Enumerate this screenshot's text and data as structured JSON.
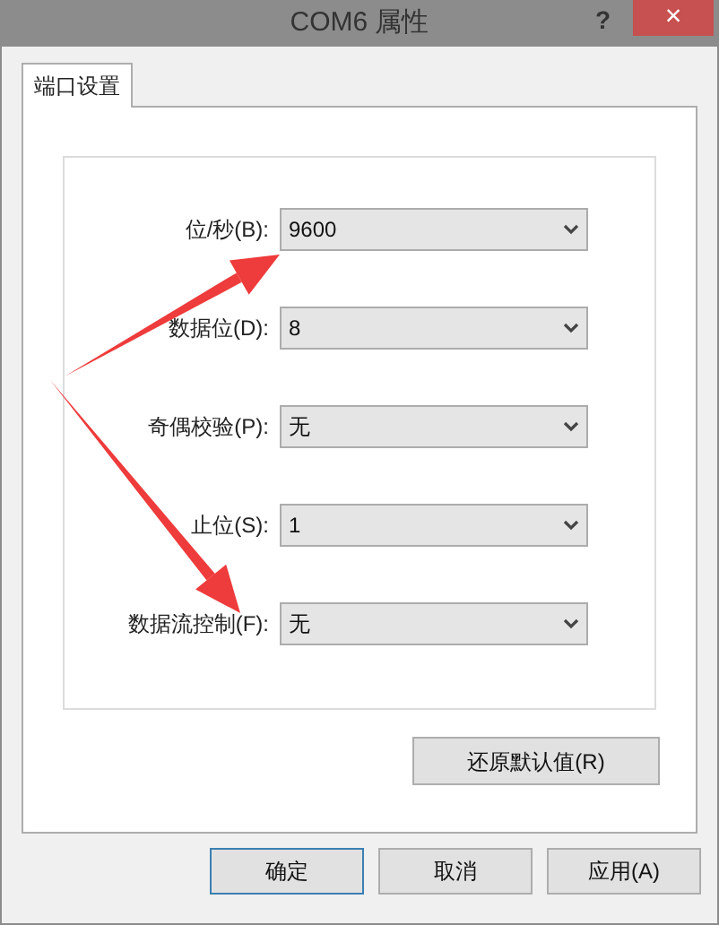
{
  "window": {
    "title": "COM6 属性",
    "help": "?",
    "close": "×"
  },
  "tabs": [
    {
      "label": "端口设置",
      "selected": true
    }
  ],
  "settings": [
    {
      "label": "位/秒(B):",
      "value": "9600"
    },
    {
      "label": "数据位(D):",
      "value": "8"
    },
    {
      "label": "奇偶校验(P):",
      "value": "无"
    },
    {
      "label": "止位(S):",
      "value": "1"
    },
    {
      "label": "数据流控制(F):",
      "value": "无"
    }
  ],
  "restore_button": "还原默认值(R)",
  "buttons": [
    "确定",
    "取消",
    "应用(A)"
  ],
  "annotations": [
    {
      "kind": "arrow"
    },
    {
      "kind": "arrow"
    }
  ]
}
